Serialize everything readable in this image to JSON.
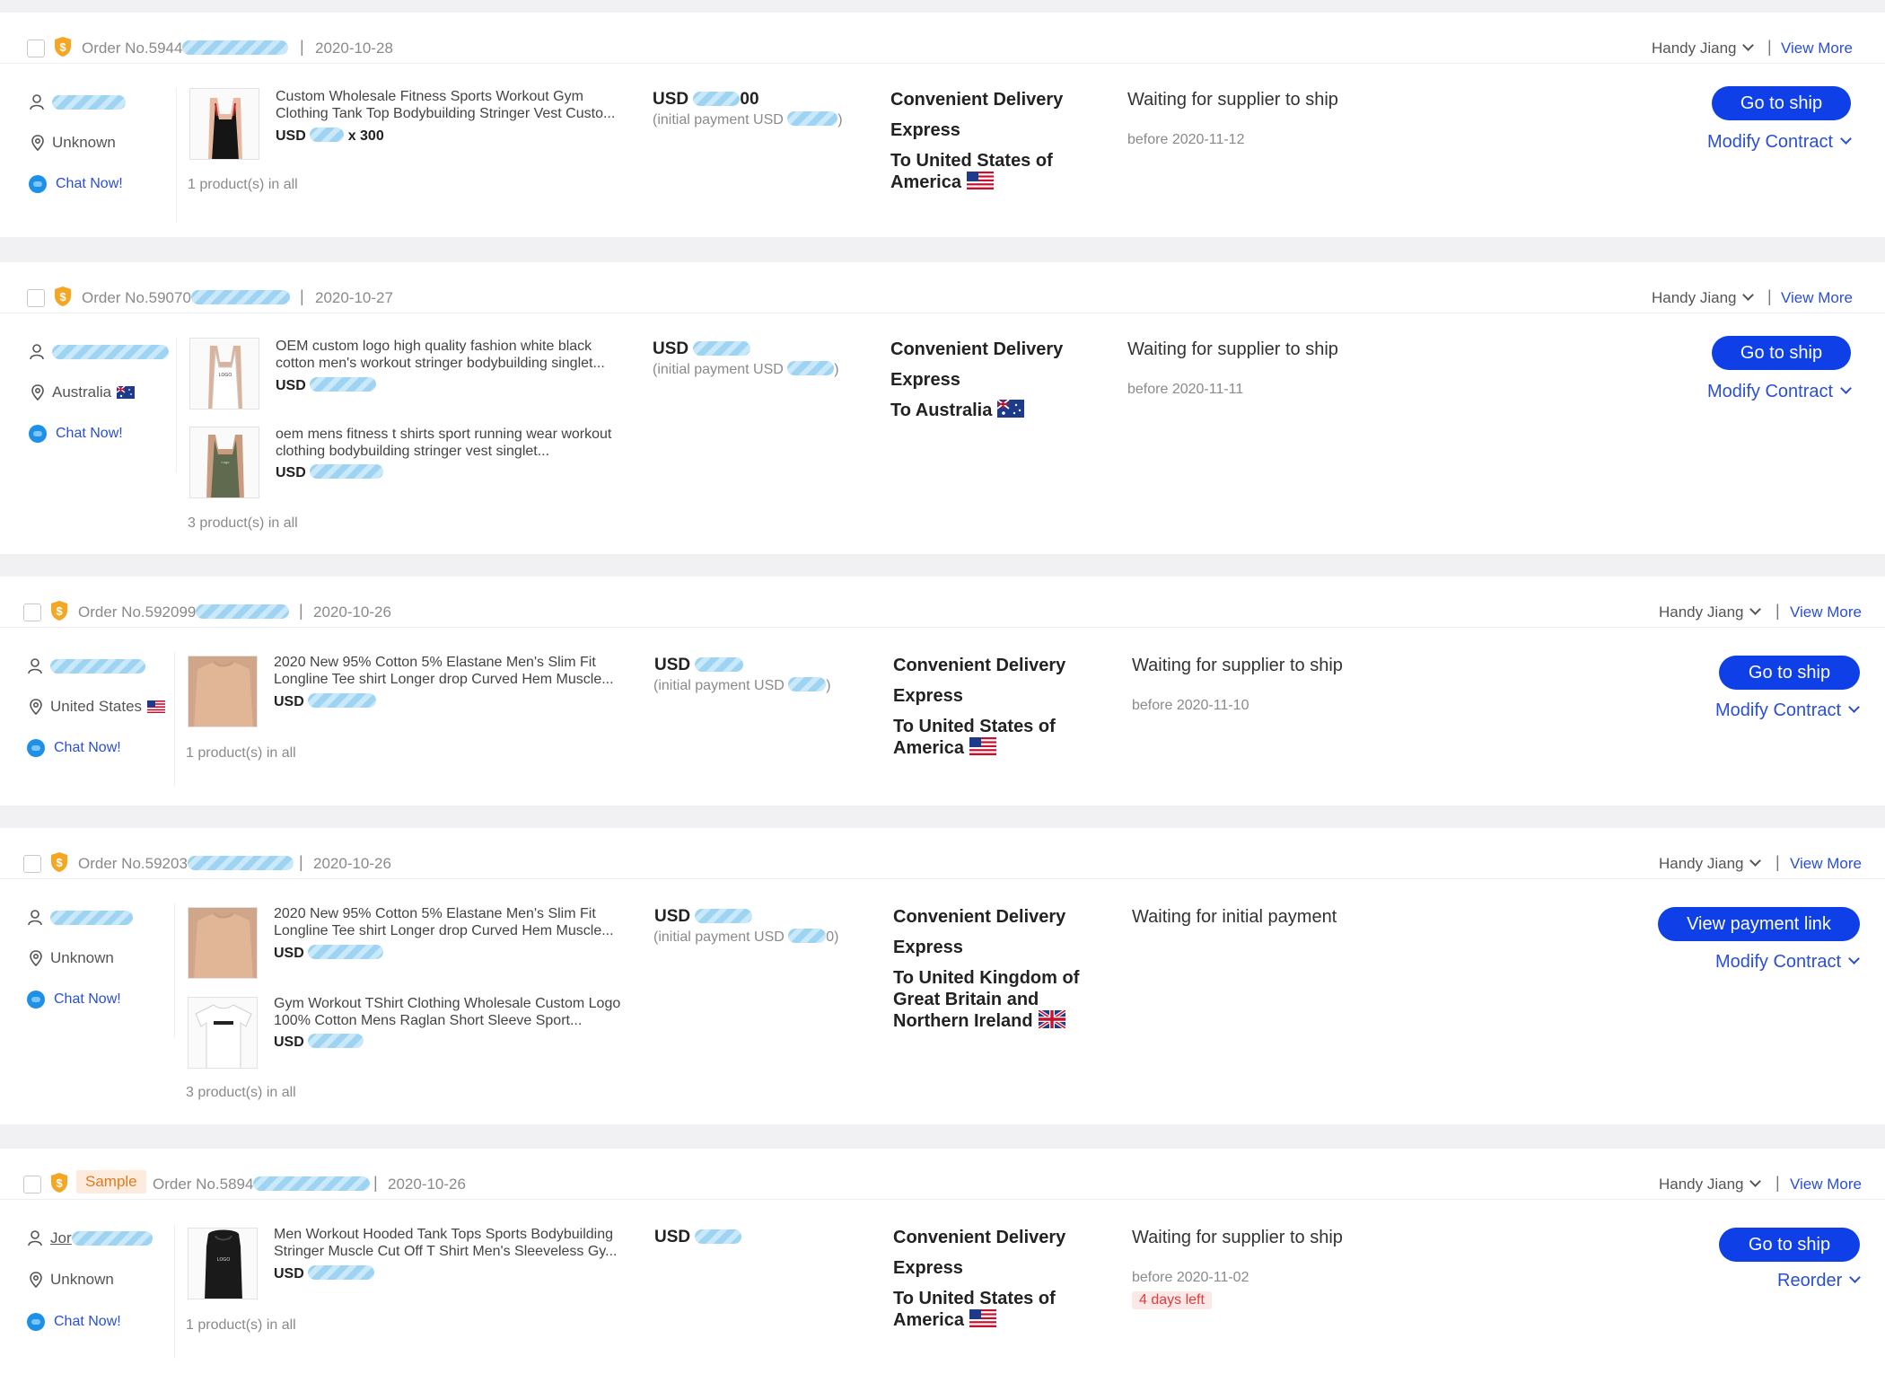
{
  "common": {
    "chat": "Chat Now!",
    "view_more": "View More",
    "sep": "|",
    "currency": "USD",
    "initial_payment": "(initial payment USD",
    "initial_payment_close": ")",
    "shipping_method_1": "Convenient Delivery",
    "shipping_method_2": "Express",
    "modify_contract": "Modify Contract",
    "go_to_ship": "Go to ship"
  },
  "orders": [
    {
      "order_no": "Order No.5944",
      "date": "2020-10-28",
      "person": "Handy Jiang",
      "location": "Unknown",
      "products": [
        {
          "title": "Custom Wholesale Fitness Sports Workout Gym Clothing Tank Top Bodybuilding Stringer Vest Custo...",
          "price_prefix": "USD",
          "qty": "x 300"
        }
      ],
      "products_count": "1 product(s) in all",
      "amount_prefix": "USD",
      "amount_suffix": "00",
      "ship_to": "To United States of America",
      "status": "Waiting for supplier to ship",
      "due": "before 2020-11-12",
      "primary_action": "Go to ship",
      "secondary_action": "Modify Contract"
    },
    {
      "order_no": "Order No.59070",
      "date": "2020-10-27",
      "person": "Handy Jiang",
      "location": "Australia",
      "products": [
        {
          "title": "OEM custom logo high quality fashion white black cotton men's workout stringer bodybuilding singlet...",
          "price_prefix": "USD"
        },
        {
          "title": "oem mens fitness t shirts sport running wear workout clothing bodybuilding stringer vest singlet...",
          "price_prefix": "USD"
        }
      ],
      "products_count": "3 product(s) in all",
      "amount_prefix": "USD",
      "ship_to": "To Australia",
      "status": "Waiting for supplier to ship",
      "due": "before 2020-11-11",
      "primary_action": "Go to ship",
      "secondary_action": "Modify Contract"
    },
    {
      "order_no": "Order No.592099",
      "date": "2020-10-26",
      "person": "Handy Jiang",
      "location": "United States",
      "products": [
        {
          "title": "2020 New 95% Cotton 5% Elastane Men's Slim Fit Longline Tee shirt Longer drop Curved Hem Muscle...",
          "price_prefix": "USD"
        }
      ],
      "products_count": "1 product(s) in all",
      "amount_prefix": "USD",
      "ship_to": "To United States of America",
      "status": "Waiting for supplier to ship",
      "due": "before 2020-11-10",
      "primary_action": "Go to ship",
      "secondary_action": "Modify Contract"
    },
    {
      "order_no": "Order No.59203",
      "date": "2020-10-26",
      "person": "Handy Jiang",
      "location": "Unknown",
      "products": [
        {
          "title": "2020 New 95% Cotton 5% Elastane Men's Slim Fit Longline Tee shirt Longer drop Curved Hem Muscle...",
          "price_prefix": "USD"
        },
        {
          "title": "Gym Workout TShirt Clothing Wholesale Custom Logo 100% Cotton Mens Raglan Short Sleeve Sport...",
          "price_prefix": "USD"
        }
      ],
      "products_count": "3 product(s) in all",
      "amount_prefix": "USD",
      "initial_payment_close": "0)",
      "ship_to": "To United Kingdom of Great Britain and Northern Ireland",
      "status": "Waiting for initial payment",
      "primary_action": "View payment link",
      "secondary_action": "Modify Contract"
    },
    {
      "badge": "Sample",
      "order_no": "Order No.5894",
      "date": "2020-10-26",
      "person": "Handy Jiang",
      "buyer_name": "Jor",
      "location": "Unknown",
      "products": [
        {
          "title": "Men Workout Hooded Tank Tops Sports Bodybuilding Stringer Muscle Cut Off T Shirt Men's Sleeveless Gy...",
          "price_prefix": "USD"
        }
      ],
      "products_count": "1 product(s) in all",
      "amount_prefix": "USD",
      "ship_to": "To United States of America",
      "status": "Waiting for supplier to ship",
      "due": "before 2020-11-02",
      "days_left": "4 days left",
      "primary_action": "Go to ship",
      "secondary_action": "Reorder"
    }
  ],
  "icons": {
    "shield": "shield-dollar-icon",
    "user": "user-icon",
    "location": "location-pin-icon",
    "chat": "chat-bubble-icon",
    "dropdown": "chevron-down-icon"
  },
  "colors": {
    "primary": "#0f3fe6",
    "link": "#2a4fd6",
    "badge_bg": "#fdecdd",
    "badge_text": "#e07a1f",
    "alert": "#e03b3b"
  }
}
